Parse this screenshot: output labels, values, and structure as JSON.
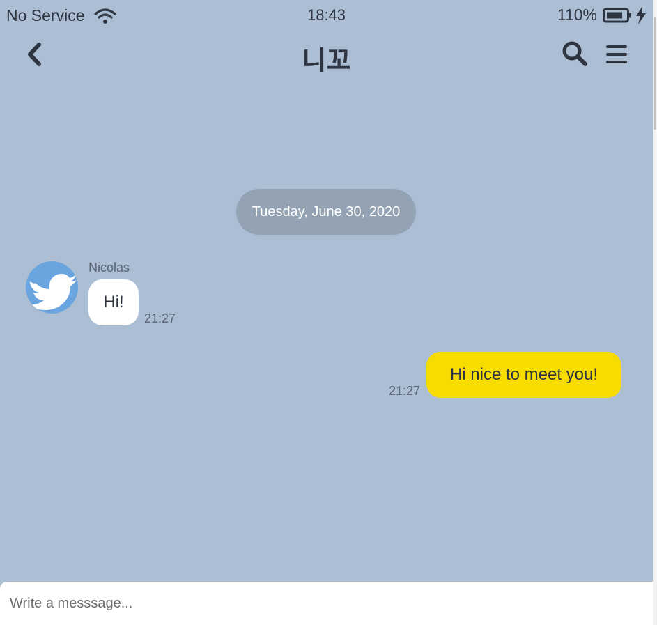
{
  "status_bar": {
    "carrier": "No Service",
    "time": "18:43",
    "battery_percent": "110%",
    "icons": [
      "wifi-icon",
      "battery-icon",
      "bolt-icon"
    ]
  },
  "header": {
    "title": "니꼬",
    "back_icon": "chevron-left-icon",
    "search_icon": "search-icon",
    "menu_icon": "menu-icon"
  },
  "chat": {
    "date_divider": "Tuesday, June 30, 2020",
    "messages": [
      {
        "direction": "incoming",
        "sender": "Nicolas",
        "avatar_icon": "twitter-bird-icon",
        "text": "Hi!",
        "time": "21:27"
      },
      {
        "direction": "outgoing",
        "text": "Hi nice to meet you!",
        "time": "21:27"
      }
    ]
  },
  "composer": {
    "placeholder": "Write a messsage...",
    "value": ""
  },
  "colors": {
    "background": "#abbed4",
    "outgoing_bubble": "#f6dc00",
    "incoming_bubble": "#ffffff",
    "date_pill": "#93a3b3",
    "avatar": "#6aa5e0"
  }
}
